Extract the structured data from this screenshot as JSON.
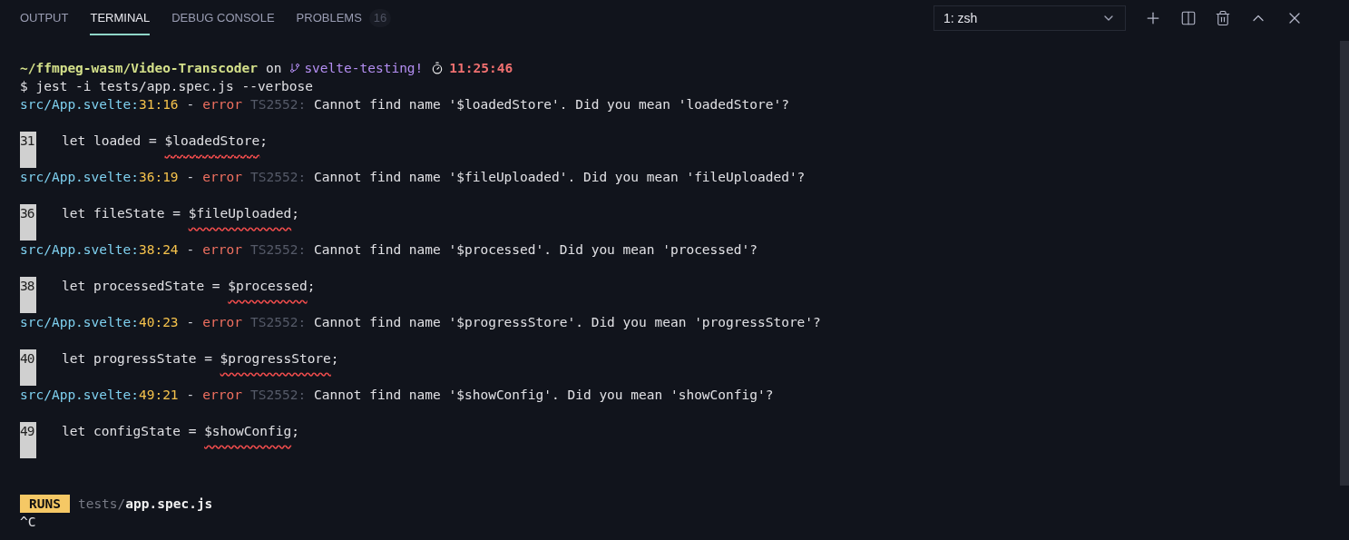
{
  "tabs": [
    {
      "label": "OUTPUT",
      "selected": false
    },
    {
      "label": "TERMINAL",
      "selected": true
    },
    {
      "label": "DEBUG CONSOLE",
      "selected": false
    },
    {
      "label": "PROBLEMS",
      "selected": false,
      "badge": "16"
    }
  ],
  "terminal_select": {
    "value": "1: zsh"
  },
  "prompt": {
    "path": "~/ffmpeg-wasm/Video-Transcoder",
    "on": "on",
    "branch": "svelte-testing!",
    "time": "11:25:46"
  },
  "command": "$ jest -i tests/app.spec.js --verbose",
  "errors": [
    {
      "file": "src/App.svelte:",
      "position": "31:16",
      "separator": "-",
      "level": "error",
      "code": "TS2552:",
      "message": "Cannot find name '$loadedStore'. Did you mean 'loadedStore'?",
      "line_number": "31",
      "code_before": "let loaded = ",
      "code_error": "$loadedStore",
      "code_after": ";"
    },
    {
      "file": "src/App.svelte:",
      "position": "36:19",
      "separator": "-",
      "level": "error",
      "code": "TS2552:",
      "message": "Cannot find name '$fileUploaded'. Did you mean 'fileUploaded'?",
      "line_number": "36",
      "code_before": "let fileState = ",
      "code_error": "$fileUploaded",
      "code_after": ";"
    },
    {
      "file": "src/App.svelte:",
      "position": "38:24",
      "separator": "-",
      "level": "error",
      "code": "TS2552:",
      "message": "Cannot find name '$processed'. Did you mean 'processed'?",
      "line_number": "38",
      "code_before": "let processedState = ",
      "code_error": "$processed",
      "code_after": ";"
    },
    {
      "file": "src/App.svelte:",
      "position": "40:23",
      "separator": "-",
      "level": "error",
      "code": "TS2552:",
      "message": "Cannot find name '$progressStore'. Did you mean 'progressStore'?",
      "line_number": "40",
      "code_before": "let progressState = ",
      "code_error": "$progressStore",
      "code_after": ";"
    },
    {
      "file": "src/App.svelte:",
      "position": "49:21",
      "separator": "-",
      "level": "error",
      "code": "TS2552:",
      "message": "Cannot find name '$showConfig'. Did you mean 'showConfig'?",
      "line_number": "49",
      "code_before": "let configState = ",
      "code_error": "$showConfig",
      "code_after": ";"
    }
  ],
  "runs": {
    "badge": "RUNS",
    "dir": "tests/",
    "file": "app.spec.js"
  },
  "interrupt": "^C"
}
